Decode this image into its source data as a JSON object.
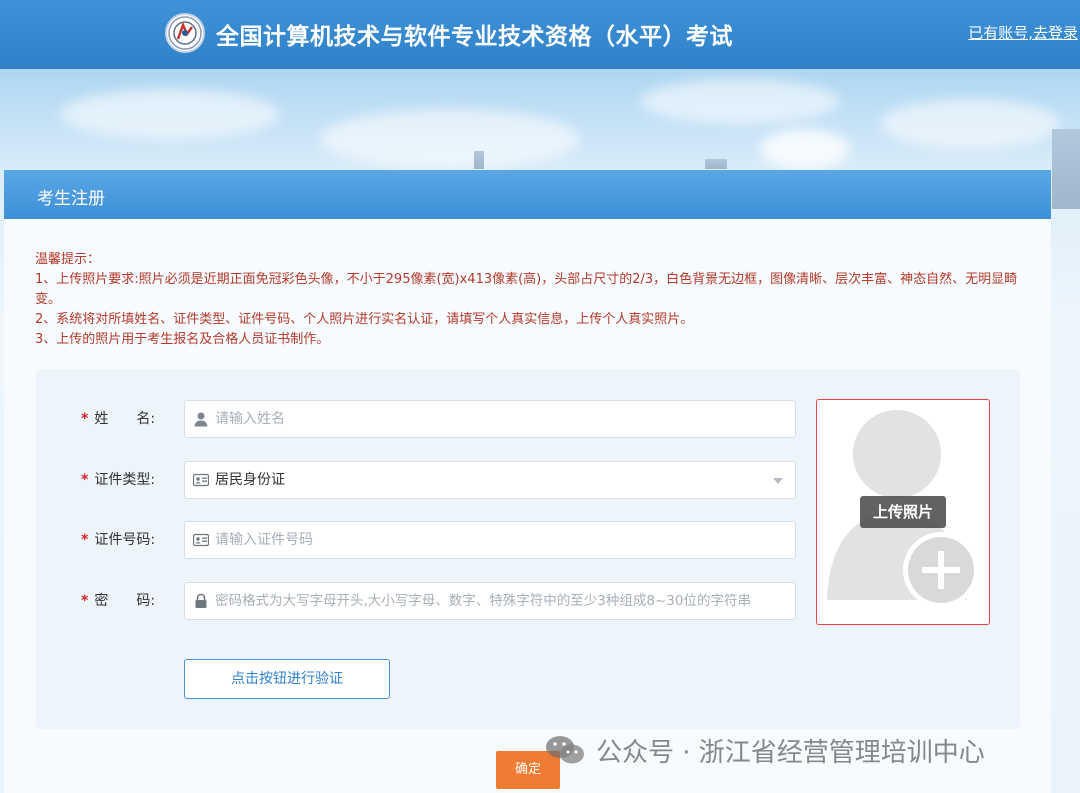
{
  "header": {
    "title": "全国计算机技术与软件专业技术资格（水平）考试",
    "login_link": "已有账号,去登录",
    "logo_icon": "exam-logo-icon"
  },
  "panel": {
    "title": "考生注册"
  },
  "tips": {
    "heading": "温馨提示：",
    "items": [
      "1、上传照片要求:照片必须是近期正面免冠彩色头像，不小于295像素(宽)x413像素(高)，头部占尺寸的2/3，白色背景无边框，图像清晰、层次丰富、神态自然、无明显畸变。",
      "2、系统将对所填姓名、证件类型、证件号码、个人照片进行实名认证，请填写个人真实信息，上传个人真实照片。",
      "3、上传的照片用于考生报名及合格人员证书制作。"
    ]
  },
  "form": {
    "required_mark": "*",
    "name": {
      "label": "姓　　名:",
      "placeholder": "请输入姓名",
      "icon": "user-icon"
    },
    "id_type": {
      "label": "证件类型:",
      "value": "居民身份证",
      "icon": "id-card-icon"
    },
    "id_number": {
      "label": "证件号码:",
      "placeholder": "请输入证件号码",
      "icon": "id-card-icon"
    },
    "password": {
      "label": "密　　码:",
      "placeholder": "密码格式为大写字母开头,大小写字母、数字、特殊字符中的至少3种组成8~30位的字符串",
      "icon": "lock-icon"
    },
    "verify_button": "点击按钮进行验证",
    "upload_photo": "上传照片",
    "confirm_button": "确定"
  },
  "watermark": {
    "text": "公众号 · 浙江省经营管理培训中心",
    "icon": "wechat-icon"
  },
  "colors": {
    "header_bg": "#2f80c9",
    "panel_head": "#4a97dc",
    "tip_text": "#b33a2a",
    "required": "#e02020",
    "confirm_bg": "#f07b33",
    "photo_border": "#e8424b"
  }
}
